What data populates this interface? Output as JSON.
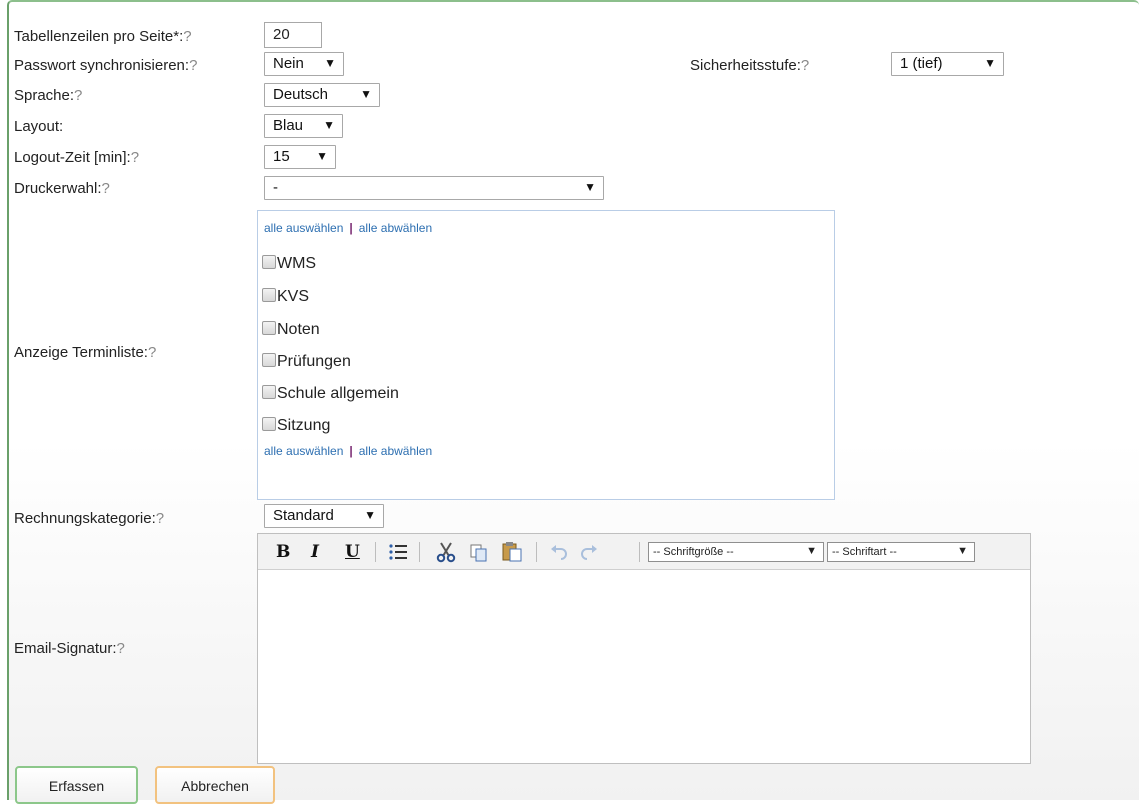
{
  "fields": {
    "table_rows": {
      "label": "Tabellenzeilen pro Seite*:",
      "help": "?",
      "value": "20"
    },
    "password_sync": {
      "label": "Passwort synchronisieren:",
      "help": "?",
      "value": "Nein"
    },
    "security_level": {
      "label": "Sicherheitsstufe:",
      "help": "?",
      "value": "1 (tief)"
    },
    "language": {
      "label": "Sprache:",
      "help": "?",
      "value": "Deutsch"
    },
    "layout": {
      "label": "Layout:",
      "value": "Blau"
    },
    "logout_time": {
      "label": "Logout-Zeit [min]:",
      "help": "?",
      "value": "15"
    },
    "printer": {
      "label": "Druckerwahl:",
      "help": "?",
      "value": "-"
    },
    "appointment_list": {
      "label": "Anzeige Terminliste:",
      "help": "?",
      "select_all": "alle auswählen",
      "deselect_all": "alle abwählen",
      "separator": "|",
      "options": [
        "WMS",
        "KVS",
        "Noten",
        "Prüfungen",
        "Schule allgemein",
        "Sitzung"
      ]
    },
    "invoice_category": {
      "label": "Rechnungskategorie:",
      "help": "?",
      "value": "Standard"
    },
    "email_signature": {
      "label": "Email-Signatur:",
      "help": "?",
      "toolbar": {
        "bold": "B",
        "italic": "I",
        "underline": "U",
        "font_size": "-- Schriftgröße --",
        "font_family": "-- Schriftart --"
      }
    }
  },
  "icons": {
    "dropdown": "▼",
    "list": "list-icon",
    "cut": "scissors-icon",
    "copy": "copy-icon",
    "paste": "paste-icon",
    "undo": "undo-icon",
    "redo": "redo-icon"
  },
  "buttons": {
    "submit": "Erfassen",
    "cancel": "Abbrechen"
  },
  "colors": {
    "submit_border": "#8cc78a",
    "cancel_border": "#f2c27f",
    "link": "#2d6fb1"
  }
}
